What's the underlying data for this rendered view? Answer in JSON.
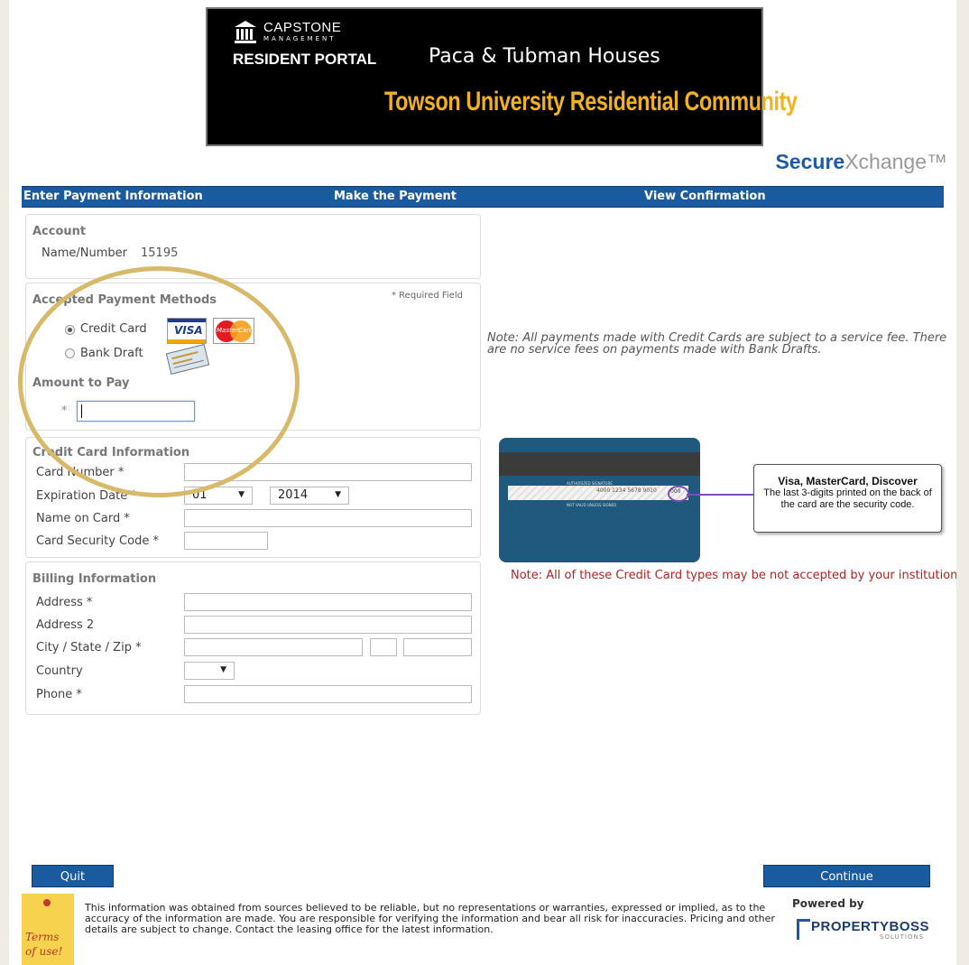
{
  "header": {
    "logo_name": "CAPSTONE",
    "logo_sub": "MANAGEMENT",
    "portal_label": "RESIDENT PORTAL",
    "property_title": "Paca & Tubman Houses",
    "property_subtitle": "Towson University Residential Community",
    "brand_bold": "Secure",
    "brand_rest": "Xchange™"
  },
  "steps": [
    "Enter Payment Information",
    "Make the Payment",
    "View Confirmation"
  ],
  "account": {
    "title": "Account",
    "name_label": "Name/Number",
    "name_value": "15195"
  },
  "payment_methods": {
    "title": "Accepted Payment Methods",
    "required_note": "* Required Field",
    "options": [
      "Credit Card",
      "Bank Draft"
    ],
    "selected": "Credit Card",
    "amount_title": "Amount to Pay",
    "amount_star": "*",
    "visa_text": "VISA",
    "mastercard_text": "MasterCard"
  },
  "credit_card": {
    "title": "Credit Card Information",
    "fields": {
      "card_number": "Card Number *",
      "expiration": "Expiration Date *",
      "name_on_card": "Name on Card *",
      "security_code": "Card Security Code *"
    },
    "exp_month": "01",
    "exp_year": "2014"
  },
  "billing": {
    "title": "Billing Information",
    "address": "Address *",
    "address2": "Address 2",
    "city_state_zip": "City / State / Zip *",
    "country": "Country",
    "phone": "Phone *"
  },
  "notes": {
    "service_fee": "Note: All payments made with Credit Cards are subject to a service fee. There are no service fees on payments made with Bank Drafts.",
    "card_types": "Note:  All of these Credit Card types may be not accepted by your institution."
  },
  "card_image": {
    "signature_label": "AUTHORIZED SIGNATURE",
    "card_digits": "4000 1234 5678 9010",
    "cvv": "000",
    "not_valid": "NOT VALID UNLESS SIGNED",
    "callout_title": "Visa, MasterCard, Discover",
    "callout_text": "The last 3-digits printed on the back of the card are the security code."
  },
  "buttons": {
    "quit": "Quit",
    "continue": "Continue"
  },
  "footer": {
    "disclaimer": "This information was obtained from sources believed to be reliable, but no representations or warranties, expressed or implied, as to the accuracy of the information are made.  You are responsible for verifying the information and bear all risk for inaccuracies.  Pricing and other details are subject to change.  Contact the leasing office for the latest information.",
    "terms": "Terms of use!",
    "powered_by": "Powered by",
    "pb_logo": "PROPERTYBOSS",
    "pb_sub": "SOLUTIONS"
  },
  "colors": {
    "nav_blue": "#1a5a9e",
    "accent_gold": "#f2b21f",
    "highlight_ring": "#d8b96a",
    "warning_red": "#b22222"
  }
}
